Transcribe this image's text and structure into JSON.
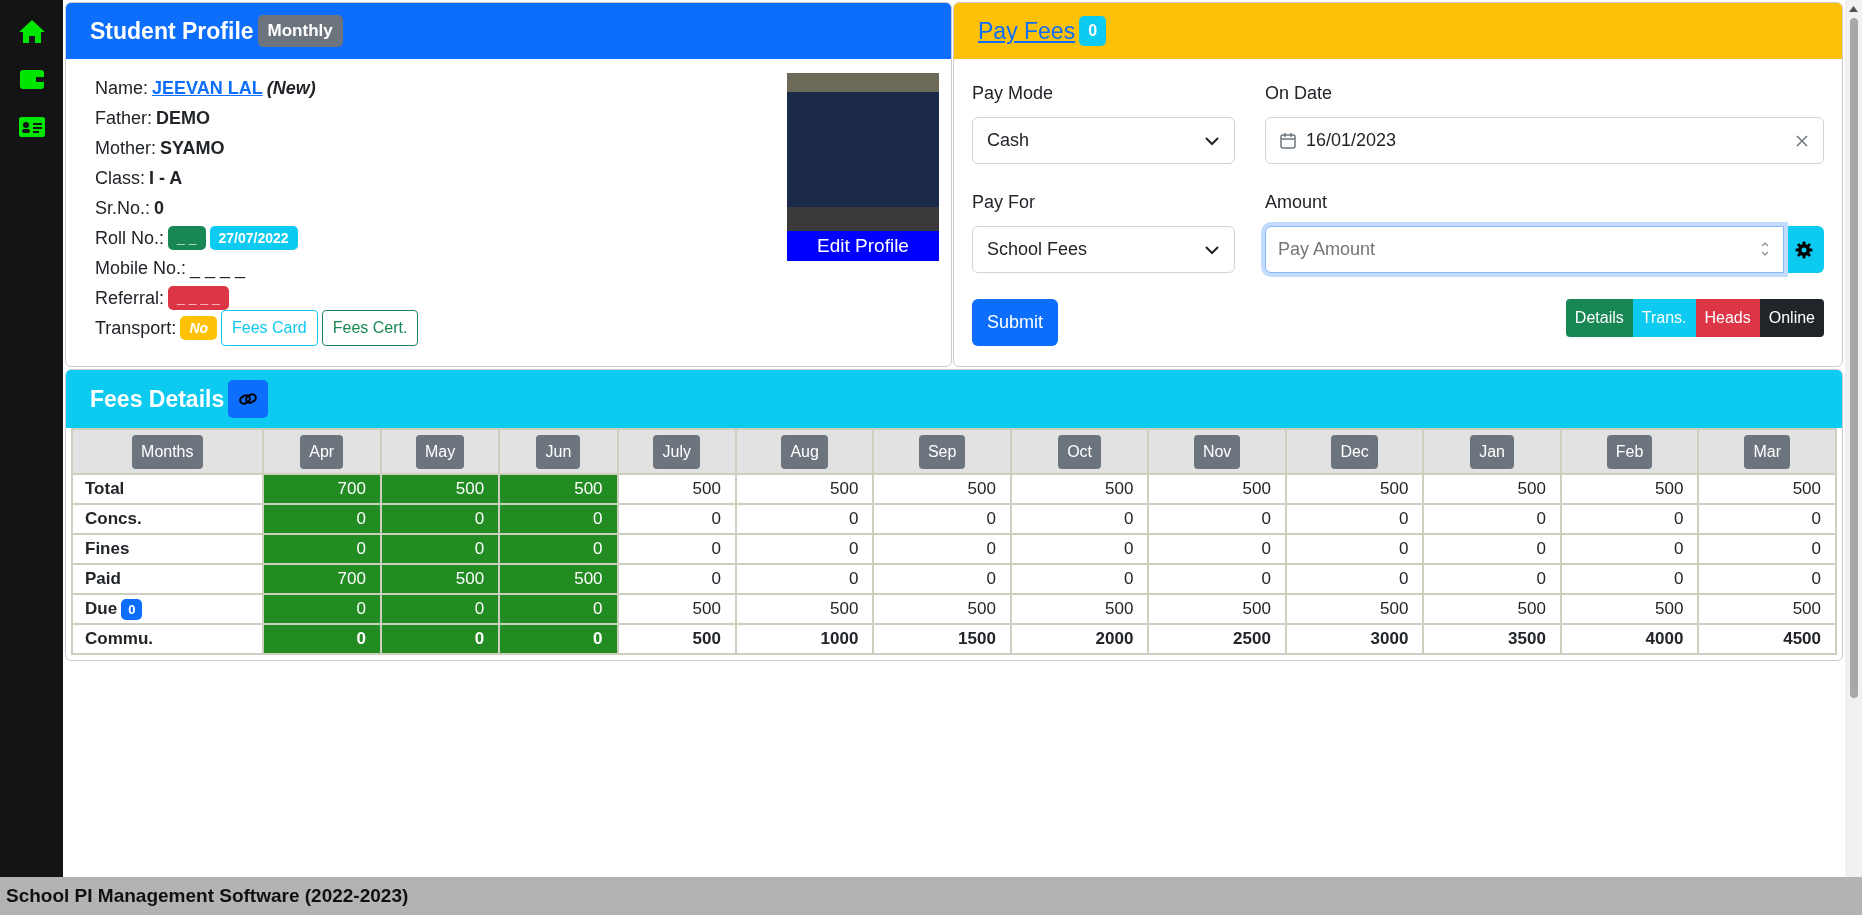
{
  "sidebar": {
    "items": [
      {
        "kind": "home",
        "selected": false
      },
      {
        "kind": "wallet",
        "selected": false
      },
      {
        "kind": "card",
        "selected": false
      }
    ]
  },
  "profile": {
    "title": "Student Profile",
    "badge": "Monthly",
    "fields": [
      {
        "kind": "link",
        "label": "Name:",
        "value": "JEEVAN LAL",
        "note": "(New)"
      },
      {
        "kind": "text",
        "label": "Father:",
        "value": "DEMO"
      },
      {
        "kind": "text",
        "label": "Mother:",
        "value": "SYAMO"
      },
      {
        "kind": "text",
        "label": "Class:",
        "value": "I - A"
      },
      {
        "kind": "text",
        "label": "Sr.No.:",
        "value": "0"
      },
      {
        "kind": "badges",
        "label": "Roll No.:",
        "badges": [
          {
            "text": "_ _",
            "color": "#198754"
          },
          {
            "text": "27/07/2022",
            "color": "#0dcaf0"
          }
        ]
      },
      {
        "kind": "plain",
        "label": "Mobile No.:",
        "value": "_ _ _ _"
      },
      {
        "kind": "badges",
        "label": "Referral:",
        "badges": [
          {
            "text": "_ _ _ _",
            "color": "#dc3545"
          }
        ]
      },
      {
        "kind": "badges",
        "label": "Transport:",
        "badges": [
          {
            "text": "No",
            "color": "#ffc107"
          }
        ],
        "buttons": [
          {
            "label": "Fees Card",
            "color": "#0dcaf0"
          },
          {
            "label": "Fees Cert.",
            "color": "#198754"
          }
        ]
      }
    ],
    "photo_button": "Edit Profile"
  },
  "pay_fees": {
    "title": "Pay Fees",
    "badge": "0",
    "pay_mode": {
      "label": "Pay Mode",
      "value": "Cash"
    },
    "on_date": {
      "label": "On Date",
      "value": "16/01/2023"
    },
    "pay_for": {
      "label": "Pay For",
      "value": "School Fees"
    },
    "amount": {
      "label": "Amount",
      "placeholder": "Pay Amount"
    },
    "submit": "Submit",
    "buttons": [
      {
        "label": "Details",
        "color": "#198754"
      },
      {
        "label": "Trans.",
        "color": "#0dcaf0"
      },
      {
        "label": "Heads",
        "color": "#dc3545"
      },
      {
        "label": "Online",
        "color": "#212529"
      }
    ]
  },
  "fees_details": {
    "title": "Fees Details",
    "columns": [
      "Months",
      "Apr",
      "May",
      "Jun",
      "July",
      "Aug",
      "Sep",
      "Oct",
      "Nov",
      "Dec",
      "Jan",
      "Feb",
      "Mar"
    ],
    "rows": [
      {
        "kind": "normal",
        "cells": [
          {
            "text": "Total"
          },
          {
            "text": "700",
            "paid": true
          },
          {
            "text": "500",
            "paid": true
          },
          {
            "text": "500",
            "paid": true
          },
          {
            "text": "500",
            "paid": false
          },
          {
            "text": "500",
            "paid": false
          },
          {
            "text": "500",
            "paid": false
          },
          {
            "text": "500",
            "paid": false
          },
          {
            "text": "500",
            "paid": false
          },
          {
            "text": "500",
            "paid": false
          },
          {
            "text": "500",
            "paid": false
          },
          {
            "text": "500",
            "paid": false
          },
          {
            "text": "500",
            "paid": false
          }
        ]
      },
      {
        "kind": "normal",
        "cells": [
          {
            "text": "Concs."
          },
          {
            "text": "0",
            "paid": true
          },
          {
            "text": "0",
            "paid": true
          },
          {
            "text": "0",
            "paid": true
          },
          {
            "text": "0",
            "paid": false
          },
          {
            "text": "0",
            "paid": false
          },
          {
            "text": "0",
            "paid": false
          },
          {
            "text": "0",
            "paid": false
          },
          {
            "text": "0",
            "paid": false
          },
          {
            "text": "0",
            "paid": false
          },
          {
            "text": "0",
            "paid": false
          },
          {
            "text": "0",
            "paid": false
          },
          {
            "text": "0",
            "paid": false
          }
        ]
      },
      {
        "kind": "normal",
        "cells": [
          {
            "text": "Fines"
          },
          {
            "text": "0",
            "paid": true
          },
          {
            "text": "0",
            "paid": true
          },
          {
            "text": "0",
            "paid": true
          },
          {
            "text": "0",
            "paid": false
          },
          {
            "text": "0",
            "paid": false
          },
          {
            "text": "0",
            "paid": false
          },
          {
            "text": "0",
            "paid": false
          },
          {
            "text": "0",
            "paid": false
          },
          {
            "text": "0",
            "paid": false
          },
          {
            "text": "0",
            "paid": false
          },
          {
            "text": "0",
            "paid": false
          },
          {
            "text": "0",
            "paid": false
          }
        ]
      },
      {
        "kind": "normal",
        "cells": [
          {
            "text": "Paid"
          },
          {
            "text": "700",
            "paid": true
          },
          {
            "text": "500",
            "paid": true
          },
          {
            "text": "500",
            "paid": true
          },
          {
            "text": "0",
            "paid": false
          },
          {
            "text": "0",
            "paid": false
          },
          {
            "text": "0",
            "paid": false
          },
          {
            "text": "0",
            "paid": false
          },
          {
            "text": "0",
            "paid": false
          },
          {
            "text": "0",
            "paid": false
          },
          {
            "text": "0",
            "paid": false
          },
          {
            "text": "0",
            "paid": false
          },
          {
            "text": "0",
            "paid": false
          }
        ]
      },
      {
        "kind": "normal",
        "badge": "0",
        "cells": [
          {
            "text": "Due"
          },
          {
            "text": "0",
            "paid": true
          },
          {
            "text": "0",
            "paid": true
          },
          {
            "text": "0",
            "paid": true
          },
          {
            "text": "500",
            "paid": false
          },
          {
            "text": "500",
            "paid": false
          },
          {
            "text": "500",
            "paid": false
          },
          {
            "text": "500",
            "paid": false
          },
          {
            "text": "500",
            "paid": false
          },
          {
            "text": "500",
            "paid": false
          },
          {
            "text": "500",
            "paid": false
          },
          {
            "text": "500",
            "paid": false
          },
          {
            "text": "500",
            "paid": false
          }
        ]
      },
      {
        "kind": "total",
        "cells": [
          {
            "text": "Commu."
          },
          {
            "text": "0",
            "paid": true
          },
          {
            "text": "0",
            "paid": true
          },
          {
            "text": "0",
            "paid": true
          },
          {
            "text": "500",
            "paid": false
          },
          {
            "text": "1000",
            "paid": false
          },
          {
            "text": "1500",
            "paid": false
          },
          {
            "text": "2000",
            "paid": false
          },
          {
            "text": "2500",
            "paid": false
          },
          {
            "text": "3000",
            "paid": false
          },
          {
            "text": "3500",
            "paid": false
          },
          {
            "text": "4000",
            "paid": false
          },
          {
            "text": "4500",
            "paid": false
          }
        ]
      }
    ]
  },
  "status_bar": {
    "text": "School PI Management Software (2022-2023)"
  }
}
